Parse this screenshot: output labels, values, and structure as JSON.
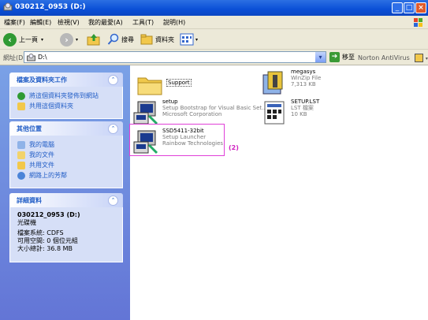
{
  "window": {
    "title": "030212_0953 (D:)"
  },
  "menu": [
    "檔案(F)",
    "編輯(E)",
    "檢視(V)",
    "我的最愛(A)",
    "工具(T)",
    "說明(H)"
  ],
  "toolbar": {
    "back_label": "上一頁",
    "search_label": "搜尋",
    "folders_label": "資料夾"
  },
  "address": {
    "label": "網址(D)",
    "value": "D:\\",
    "go_label": "移至",
    "norton_label": "Norton AntiVirus"
  },
  "tasks": {
    "title": "檔案及資料夾工作",
    "items": [
      "將這個資料夾發佈到網站",
      "共用這個資料夾"
    ]
  },
  "places": {
    "title": "其他位置",
    "items": [
      "我的電腦",
      "我的文件",
      "共用文件",
      "網路上的芳鄰"
    ]
  },
  "details": {
    "title": "詳細資料",
    "name": "030212_0953 (D:)",
    "type": "光碟機",
    "fs": "檔案系統: CDFS",
    "free": "可用空間: 0 個位元組",
    "total": "大小總計: 36.8 MB"
  },
  "files": [
    {
      "name": "Support",
      "line2": "",
      "line3": "",
      "icon": "folder-icon"
    },
    {
      "name": "megasys",
      "line2": "WinZip File",
      "line3": "7,313 KB",
      "icon": "winzip-icon"
    },
    {
      "name": "setup",
      "line2": "Setup Bootstrap for Visual Basic Set...",
      "line3": "Microsoft Corporation",
      "icon": "setup-icon"
    },
    {
      "name": "SETUP.LST",
      "line2": "LST 檔案",
      "line3": "10 KB",
      "icon": "lst-file-icon"
    },
    {
      "name": "SSD5411-32bit",
      "line2": "Setup Launcher",
      "line3": "Rainbow Technologies",
      "icon": "setup-launcher-icon"
    }
  ],
  "annotation": "(2)",
  "colors": {
    "titlebar": "#0a4fd6",
    "panel": "#6f8ee0",
    "link": "#215dc6",
    "highlight": "#e040d8"
  }
}
